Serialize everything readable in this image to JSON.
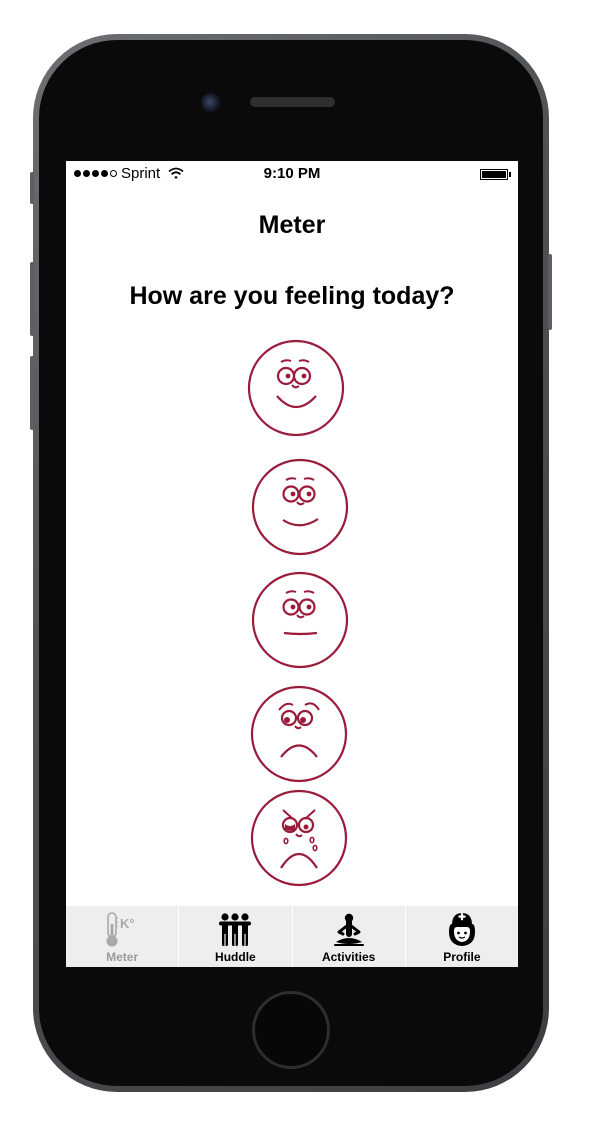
{
  "status_bar": {
    "carrier": "Sprint",
    "time": "9:10 PM",
    "signal_bars_filled": 4,
    "signal_bars_total": 5,
    "wifi_icon": "wifi-icon",
    "battery_level": 1.0
  },
  "header": {
    "title": "Meter"
  },
  "main": {
    "question": "How are you feeling today?",
    "moods": [
      {
        "name": "very-happy",
        "icon": "very-happy-face-icon"
      },
      {
        "name": "happy",
        "icon": "happy-face-icon"
      },
      {
        "name": "neutral",
        "icon": "neutral-face-icon"
      },
      {
        "name": "sad",
        "icon": "sad-face-icon"
      },
      {
        "name": "crying",
        "icon": "crying-face-icon"
      }
    ]
  },
  "tabs": [
    {
      "label": "Meter",
      "icon": "thermometer-icon",
      "active": true
    },
    {
      "label": "Huddle",
      "icon": "group-people-icon",
      "active": false
    },
    {
      "label": "Activities",
      "icon": "meditation-icon",
      "active": false
    },
    {
      "label": "Profile",
      "icon": "nurse-icon",
      "active": false
    }
  ],
  "colors": {
    "face_stroke": "#9b1b3a",
    "tab_bar_bg": "#eeeeee",
    "inactive_tab_label": "#9c9c9c"
  }
}
